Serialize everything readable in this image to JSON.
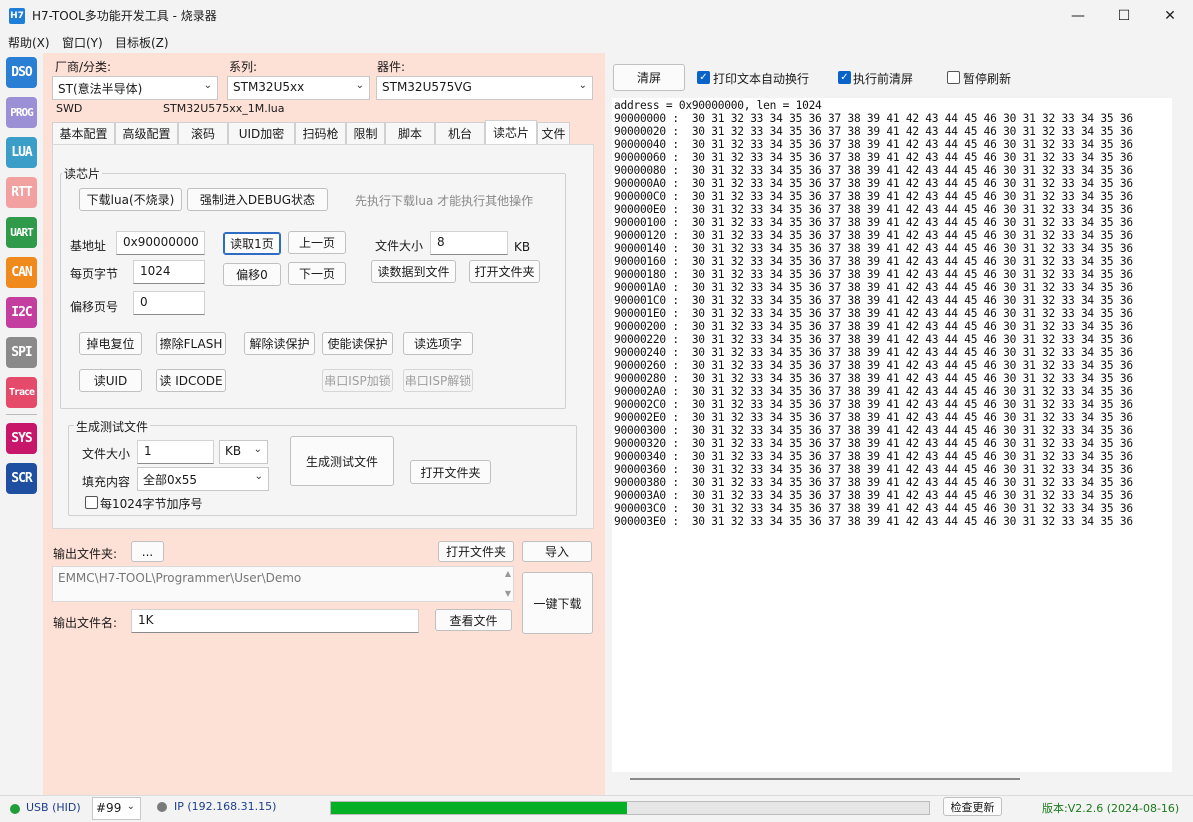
{
  "window": {
    "icon_text": "H7",
    "title": "H7-TOOL多功能开发工具 - 烧录器"
  },
  "menu": [
    "帮助(X)",
    "窗口(Y)",
    "目标板(Z)"
  ],
  "sidebar": [
    {
      "label": "DSO",
      "color": "#2a7fd4"
    },
    {
      "label": "PROG",
      "color": "#9b8fd6"
    },
    {
      "label": "LUA",
      "color": "#3a9ec9"
    },
    {
      "label": "RTT",
      "color": "#f2a0a0"
    },
    {
      "label": "UART",
      "color": "#2e9a4a"
    },
    {
      "label": "CAN",
      "color": "#f08a1c"
    },
    {
      "label": "I2C",
      "color": "#c43ea0"
    },
    {
      "label": "SPI",
      "color": "#8a8a8a"
    },
    {
      "label": "Trace",
      "color": "#e64a6a"
    },
    {
      "label": "SYS",
      "color": "#c8176a"
    },
    {
      "label": "SCR",
      "color": "#1f4fa0"
    }
  ],
  "selectors": {
    "vendor_label": "厂商/分类:",
    "vendor_value": "ST(意法半导体)",
    "series_label": "系列:",
    "series_value": "STM32U5xx",
    "device_label": "器件:",
    "device_value": "STM32U575VG",
    "interface": "SWD",
    "lua_file": "STM32U575xx_1M.lua"
  },
  "tabs": [
    "基本配置",
    "高级配置",
    "滚码",
    "UID加密",
    "扫码枪",
    "限制",
    "脚本",
    "机台",
    "读芯片",
    "文件"
  ],
  "active_tab": "读芯片",
  "read_chip": {
    "group_title": "读芯片",
    "download_lua": "下载lua(不烧录)",
    "force_debug": "强制进入DEBUG状态",
    "hint": "先执行下载lua 才能执行其他操作",
    "base_addr_label": "基地址",
    "base_addr": "0x90000000",
    "bytes_per_page_label": "每页字节",
    "bytes_per_page": "1024",
    "offset_page_label": "偏移页号",
    "offset_page": "0",
    "read_page": "读取1页",
    "prev_page": "上一页",
    "offset0": "偏移0",
    "next_page": "下一页",
    "file_size_label": "文件大小",
    "file_size": "8",
    "file_size_unit": "KB",
    "read_to_file": "读数据到文件",
    "open_folder": "打开文件夹",
    "power_reset": "掉电复位",
    "erase_flash": "擦除FLASH",
    "unlock": "解除读保护",
    "lock": "使能读保护",
    "read_option": "读选项字",
    "read_uid": "读UID",
    "read_idcode": "读 IDCODE",
    "isp_lock": "串口ISP加锁",
    "isp_unlock": "串口ISP解锁"
  },
  "gen_test": {
    "group_title": "生成测试文件",
    "size_label": "文件大小",
    "size": "1",
    "unit": "KB",
    "fill_label": "填充内容",
    "fill": "全部0x55",
    "seq_label": "每1024字节加序号",
    "generate": "生成测试文件",
    "open_folder": "打开文件夹"
  },
  "output": {
    "folder_label": "输出文件夹:",
    "browse": "...",
    "open_folder": "打开文件夹",
    "import": "导入",
    "path": "EMMC\\H7-TOOL\\Programmer\\User\\Demo",
    "name_label": "输出文件名:",
    "name": "1K",
    "view_file": "查看文件",
    "one_click": "一键下载"
  },
  "right": {
    "clear": "清屏",
    "auto_wrap": "打印文本自动换行",
    "auto_wrap_checked": true,
    "clear_before": "执行前清屏",
    "clear_before_checked": true,
    "pause": "暂停刷新",
    "pause_checked": false,
    "header_line": "address = 0x90000000, len = 1024",
    "hex_bytes": "30 31 32 33 34 35 36 37 38 39 41 42 43 44 45 46 30 31 32 33 34 35 36",
    "hex_addresses": [
      "90000000",
      "90000020",
      "90000040",
      "90000060",
      "90000080",
      "900000A0",
      "900000C0",
      "900000E0",
      "90000100",
      "90000120",
      "90000140",
      "90000160",
      "90000180",
      "900001A0",
      "900001C0",
      "900001E0",
      "90000200",
      "90000220",
      "90000240",
      "90000260",
      "90000280",
      "900002A0",
      "900002C0",
      "900002E0",
      "90000300",
      "90000320",
      "90000340",
      "90000360",
      "90000380",
      "900003A0",
      "900003C0",
      "900003E0"
    ]
  },
  "status": {
    "usb": "USB (HID)",
    "usb_color": "#1f9e3a",
    "device_no": "#99",
    "ip": "IP (192.168.31.15)",
    "ip_color": "#7a7a7a",
    "progress": 0.495,
    "progress_color": "#06b025",
    "check_update": "检查更新",
    "version": "版本:V2.2.6 (2024-08-16)",
    "version_color": "#1c7a1c"
  }
}
